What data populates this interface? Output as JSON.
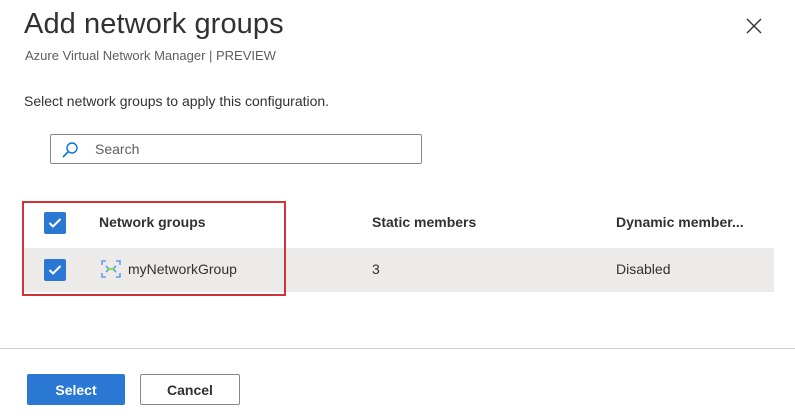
{
  "panel": {
    "title": "Add network groups",
    "subtitle": "Azure Virtual Network Manager | PREVIEW",
    "close_icon": "close-icon",
    "instruction": "Select network groups to apply this configuration."
  },
  "search": {
    "placeholder": "Search",
    "value": "",
    "icon": "search-icon"
  },
  "table": {
    "columns": [
      "Network groups",
      "Static members",
      "Dynamic member..."
    ],
    "header_checked": true,
    "rows": [
      {
        "checked": true,
        "icon": "network-group-icon",
        "name": "myNetworkGroup",
        "static_members": "3",
        "dynamic_members": "Disabled"
      }
    ]
  },
  "footer": {
    "select_label": "Select",
    "cancel_label": "Cancel"
  },
  "colors": {
    "accent": "#2b78d4",
    "highlight": "#d13438",
    "row_selected": "#edebe9"
  }
}
